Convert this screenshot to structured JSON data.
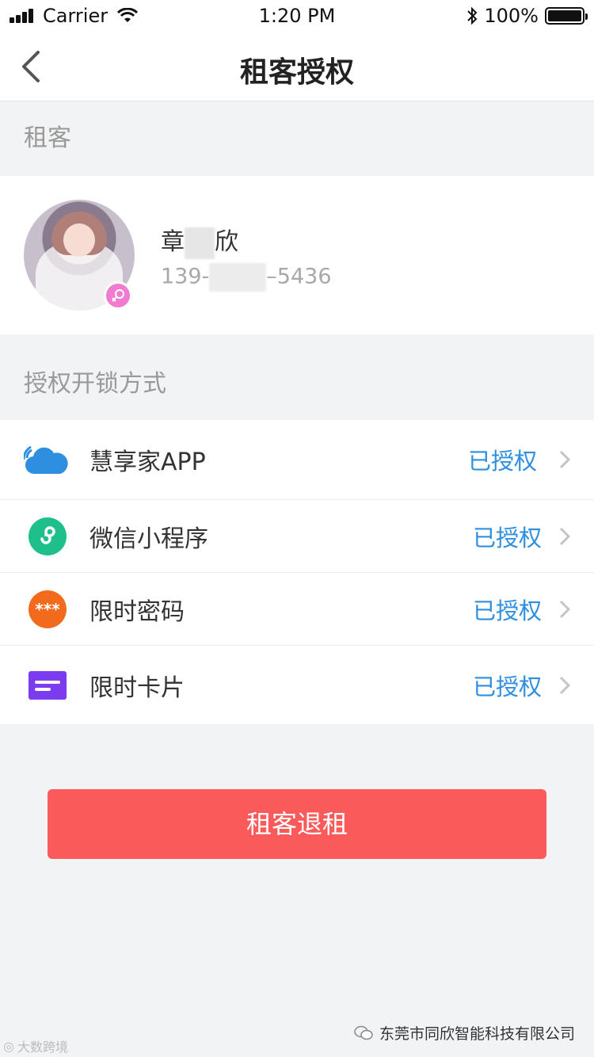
{
  "status_bar": {
    "carrier": "Carrier",
    "time": "1:20 PM",
    "battery": "100%"
  },
  "nav": {
    "title": "租客授权"
  },
  "tenant_section": {
    "header": "租客",
    "name_first": "章",
    "name_last": "欣",
    "phone_prefix": "139-",
    "phone_suffix": "–5436"
  },
  "unlock_section": {
    "header": "授权开锁方式",
    "items": [
      {
        "label": "慧享家APP",
        "status": "已授权",
        "icon": "cloud-icon",
        "color": "#2e8fe0"
      },
      {
        "label": "微信小程序",
        "status": "已授权",
        "icon": "mini-program-icon",
        "color": "#1dbf8a"
      },
      {
        "label": "限时密码",
        "status": "已授权",
        "icon": "password-icon",
        "color": "#f26b1d"
      },
      {
        "label": "限时卡片",
        "status": "已授权",
        "icon": "card-icon",
        "color": "#7b3cf0"
      }
    ]
  },
  "checkout_button": {
    "label": "租客退租",
    "color": "#fa5a5a"
  },
  "footer": {
    "company": "东莞市同欣智能科技有限公司",
    "watermark": "大数跨境"
  }
}
